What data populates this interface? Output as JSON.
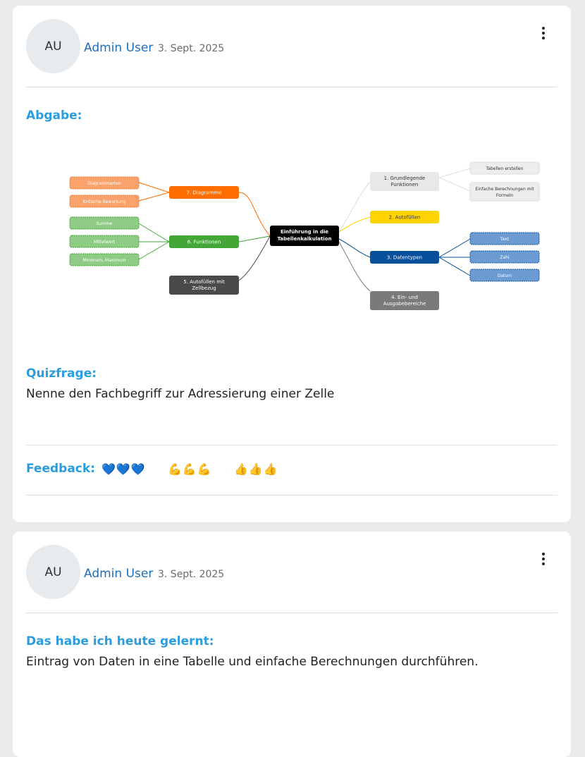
{
  "posts": [
    {
      "avatar_initials": "AU",
      "author": "Admin User",
      "date": "3. Sept. 2025",
      "sections": [
        {
          "title": "Abgabe:"
        },
        {
          "title": "Quizfrage:",
          "text": "Nenne den Fachbegriff zur Adressierung einer Zelle"
        }
      ],
      "feedback": {
        "label": "Feedback:",
        "reactions": [
          "💙💙💙",
          "💪💪💪",
          "👍👍👍"
        ]
      }
    },
    {
      "avatar_initials": "AU",
      "author": "Admin User",
      "date": "3. Sept. 2025",
      "sections": [
        {
          "title": "Das habe ich heute gelernt:",
          "text": "Eintrag von Daten in eine Tabelle und einfache Berechnungen durchführen."
        }
      ]
    }
  ],
  "mindmap": {
    "center": [
      "Einführung in die",
      "Tabellenkalkulation"
    ],
    "nodes": {
      "n1": [
        "1. Grundlegende",
        "Funktionen"
      ],
      "n1a": [
        "Tabellen erstellen"
      ],
      "n1b": [
        "Einfache Berechnungen mit",
        "Formeln"
      ],
      "n2": [
        "2. Autofüllen"
      ],
      "n3": [
        "3. Datentypen"
      ],
      "n3a": [
        "Text"
      ],
      "n3b": [
        "Zahl"
      ],
      "n3c": [
        "Datum"
      ],
      "n4": [
        "4. Ein- und",
        "Ausgabebereiche"
      ],
      "n5": [
        "5. Autofüllen mit",
        "Zellbezug"
      ],
      "n6": [
        "6. Funktionen"
      ],
      "n6a": [
        "Summe"
      ],
      "n6b": [
        "Mittelwert"
      ],
      "n6c": [
        "Minimum, Maximum"
      ],
      "n7": [
        "7. Diagramme"
      ],
      "n7a": [
        "Diagrammarten"
      ],
      "n7b": [
        "Kritische Bewertung"
      ]
    },
    "colors": {
      "orange": "#ff6d00",
      "light_orange": "#f9a26c",
      "green": "#43a637",
      "light_green": "#8ecb84",
      "dark_grey": "#4a4a4a",
      "grey": "#7a7a7a",
      "light_grey": "#e8e8e8",
      "yellow": "#ffd400",
      "blue": "#07509c",
      "light_blue": "#6c9bd2",
      "accent": "#2a9de0",
      "author": "#1d6fb8"
    }
  }
}
